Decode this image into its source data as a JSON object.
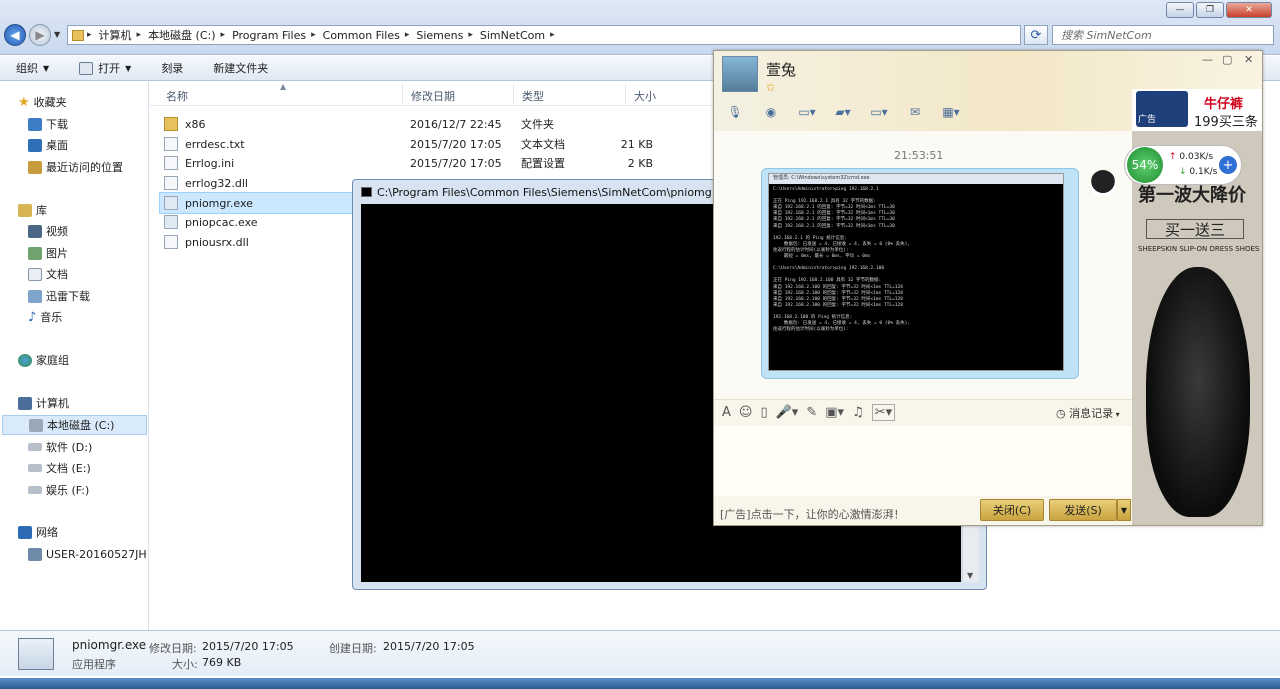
{
  "window": {
    "min_label": "—",
    "max_label": "❐",
    "close_label": "✕"
  },
  "address": {
    "crumbs": [
      "计算机",
      "本地磁盘 (C:)",
      "Program Files",
      "Common Files",
      "Siemens",
      "SimNetCom"
    ]
  },
  "search": {
    "placeholder": "搜索 SimNetCom"
  },
  "toolbar": {
    "organize": "组织",
    "open": "打开",
    "burn": "刻录",
    "new_folder": "新建文件夹"
  },
  "nav": {
    "favorites": "收藏夹",
    "downloads": "下载",
    "desktop": "桌面",
    "recent": "最近访问的位置",
    "libraries": "库",
    "videos": "视频",
    "pictures": "图片",
    "documents": "文档",
    "thunder": "迅雷下载",
    "music": "音乐",
    "homegroup": "家庭组",
    "computer": "计算机",
    "drive_c": "本地磁盘 (C:)",
    "drive_d": "软件 (D:)",
    "drive_e": "文档 (E:)",
    "drive_f": "娱乐 (F:)",
    "network": "网络",
    "pc": "USER-20160527JH"
  },
  "columns": {
    "name": "名称",
    "date": "修改日期",
    "type": "类型",
    "size": "大小"
  },
  "files": [
    {
      "name": "x86",
      "date": "2016/12/7 22:45",
      "type": "文件夹",
      "size": ""
    },
    {
      "name": "errdesc.txt",
      "date": "2015/7/20 17:05",
      "type": "文本文档",
      "size": "21 KB"
    },
    {
      "name": "Errlog.ini",
      "date": "2015/7/20 17:05",
      "type": "配置设置",
      "size": "2 KB"
    },
    {
      "name": "errlog32.dll",
      "date": "",
      "type": "",
      "size": ""
    },
    {
      "name": "pniomgr.exe",
      "date": "",
      "type": "",
      "size": ""
    },
    {
      "name": "pniopcac.exe",
      "date": "",
      "type": "",
      "size": ""
    },
    {
      "name": "pniousrx.dll",
      "date": "",
      "type": "",
      "size": ""
    }
  ],
  "details": {
    "filename": "pniomgr.exe",
    "modified_label": "修改日期:",
    "modified": "2015/7/20 17:05",
    "created_label": "创建日期:",
    "created": "2015/7/20 17:05",
    "type": "应用程序",
    "size_label": "大小:",
    "size": "769 KB"
  },
  "cmd": {
    "title": "C:\\Program Files\\Common Files\\Siemens\\SimNetCom\\pniomgr"
  },
  "qq": {
    "contact_name": "萱兔",
    "time": "21:53:51",
    "history_label": "消息记录",
    "ad_text": "[广告]点击一下，让你的心激情澎湃！",
    "close_label": "关闭(C)",
    "send_label": "发送(S)",
    "screenshot_title": "管理员: C:\\Windows\\system32\\cmd.exe",
    "screenshot_lines": [
      "C:\\Users\\Administrator>ping 192.168.2.1",
      "",
      "正在 Ping 192.168.2.1 具有 32 字节的数据:",
      "来自 192.168.2.1 的回复: 字节=32 时间<1ms TTL=30",
      "来自 192.168.2.1 的回复: 字节=32 时间<1ms TTL=30",
      "来自 192.168.2.1 的回复: 字节=32 时间<1ms TTL=30",
      "来自 192.168.2.1 的回复: 字节=32 时间<1ms TTL=30",
      "",
      "192.168.2.1 的 Ping 统计信息:",
      "    数据包: 已发送 = 4, 已接收 = 4, 丢失 = 0 (0% 丢失),",
      "往返行程的估计时间(以毫秒为单位):",
      "    最短 = 0ms, 最长 = 0ms, 平均 = 0ms",
      "",
      "C:\\Users\\Administrator>ping 192.168.2.100",
      "",
      "正在 Ping 192.168.2.100 具有 32 字节的数据:",
      "来自 192.168.2.100 的回复: 字节=32 时间<1ms TTL=128",
      "来自 192.168.2.100 的回复: 字节=32 时间<1ms TTL=128",
      "来自 192.168.2.100 的回复: 字节=32 时间<1ms TTL=128",
      "来自 192.168.2.100 的回复: 字节=32 时间<1ms TTL=128",
      "",
      "192.168.2.100 的 Ping 统计信息:",
      "    数据包: 已发送 = 4, 已接收 = 4, 丢失 = 0 (0% 丢失),",
      "往返行程的估计时间(以毫秒为单位):"
    ]
  },
  "ads": {
    "top_title": "牛仔裤",
    "top_sub": "199买三条",
    "top_tag": "广告",
    "headline": "第一波大降价",
    "offer": "买一送三",
    "brand": "SHEEPSKIN SLIP-ON DRESS SHOES"
  },
  "speed": {
    "percent": "54%",
    "up": "0.03K/s",
    "down": "0.1K/s"
  }
}
